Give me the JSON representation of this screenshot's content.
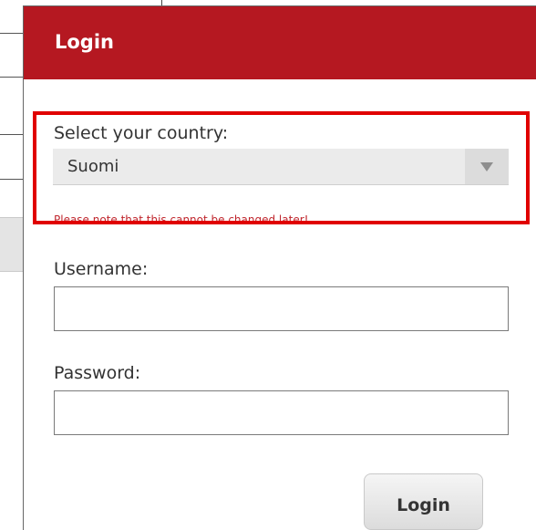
{
  "dialog": {
    "title": "Login",
    "header_color": "#b51821",
    "country": {
      "label": "Select your country:",
      "selected": "Suomi",
      "note": "Please note that this cannot be changed later!",
      "highlight_color": "#e00000"
    },
    "username": {
      "label": "Username:",
      "value": ""
    },
    "password": {
      "label": "Password:",
      "value": ""
    },
    "login_button": {
      "label": "Login"
    }
  },
  "icons": {
    "select_arrow": "chevron-down-icon"
  }
}
